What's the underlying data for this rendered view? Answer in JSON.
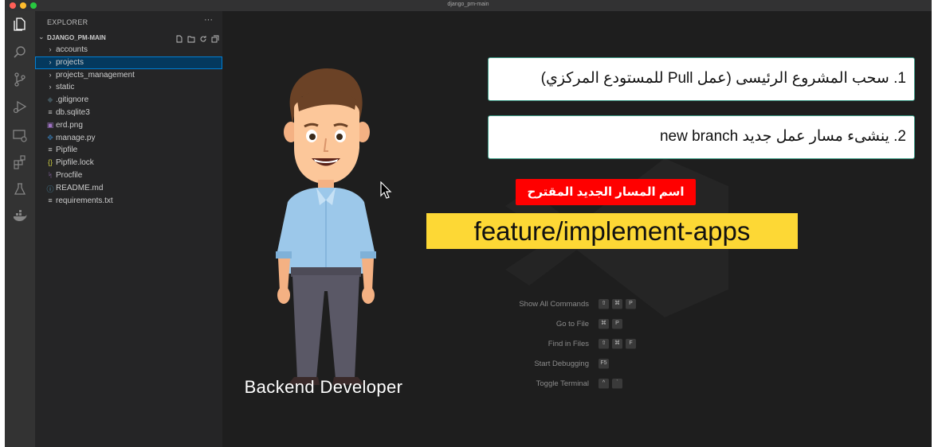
{
  "window": {
    "title": "django_pm-main"
  },
  "explorer": {
    "header": "EXPLORER",
    "more": "···",
    "project": "DJANGO_PM-MAIN",
    "items": [
      {
        "label": "accounts",
        "icon": "›",
        "icon_name": "chevron-right-icon",
        "icon_color": "#c5c5c5"
      },
      {
        "label": "projects",
        "icon": "›",
        "icon_name": "chevron-right-icon",
        "icon_color": "#c5c5c5"
      },
      {
        "label": "projects_management",
        "icon": "›",
        "icon_name": "chevron-right-icon",
        "icon_color": "#c5c5c5"
      },
      {
        "label": "static",
        "icon": "›",
        "icon_name": "chevron-right-icon",
        "icon_color": "#c5c5c5"
      },
      {
        "label": ".gitignore",
        "icon": "◆",
        "icon_name": "git-icon",
        "icon_color": "#41535b"
      },
      {
        "label": "db.sqlite3",
        "icon": "≡",
        "icon_name": "file-lines-icon",
        "icon_color": "#c5c5c5"
      },
      {
        "label": "erd.png",
        "icon": "▣",
        "icon_name": "image-file-icon",
        "icon_color": "#a074c4"
      },
      {
        "label": "manage.py",
        "icon": "✥",
        "icon_name": "python-icon",
        "icon_color": "#3572a5"
      },
      {
        "label": "Pipfile",
        "icon": "≡",
        "icon_name": "file-lines-icon",
        "icon_color": "#c5c5c5"
      },
      {
        "label": "Pipfile.lock",
        "icon": "{}",
        "icon_name": "json-braces-icon",
        "icon_color": "#cbcb41"
      },
      {
        "label": "Procfile",
        "icon": "ᛋ",
        "icon_name": "heroku-icon",
        "icon_color": "#a074c4"
      },
      {
        "label": "README.md",
        "icon": "ⓘ",
        "icon_name": "info-icon",
        "icon_color": "#519aba"
      },
      {
        "label": "requirements.txt",
        "icon": "≡",
        "icon_name": "file-lines-icon",
        "icon_color": "#c5c5c5"
      }
    ],
    "selected_item": "projects"
  },
  "activity_bar": {
    "icons": [
      "explorer-icon",
      "search-icon",
      "source-control-icon",
      "run-debug-icon",
      "remote-explorer-icon",
      "extensions-icon",
      "testing-icon",
      "docker-icon"
    ],
    "active": "explorer-icon"
  },
  "overlay": {
    "step1": "1. سحب المشروع الرئيسى (عمل Pull للمستودع المركزي)",
    "step2": "2. ينشىء مسار عمل جديد new branch",
    "red_label": "اسم المسار الجديد المقترح",
    "branch_name": "feature/implement-apps",
    "character_caption": "Backend Developer"
  },
  "shortcuts": [
    {
      "label": "Show All Commands",
      "keys": [
        "⇧",
        "⌘",
        "P"
      ]
    },
    {
      "label": "Go to File",
      "keys": [
        "⌘",
        "P"
      ]
    },
    {
      "label": "Find in Files",
      "keys": [
        "⇧",
        "⌘",
        "F"
      ]
    },
    {
      "label": "Start Debugging",
      "keys": [
        "F5"
      ]
    },
    {
      "label": "Toggle Terminal",
      "keys": [
        "^",
        "`"
      ]
    }
  ],
  "colors": {
    "bubble_border": "#3c9a85",
    "red_label": "#ff0000",
    "yellow_bar": "#fdd835",
    "selection": "#04395e",
    "selection_border": "#007fd4"
  }
}
